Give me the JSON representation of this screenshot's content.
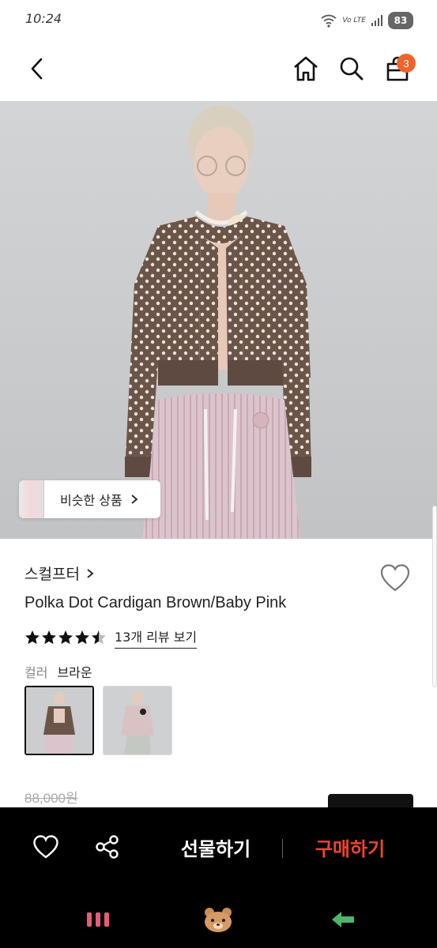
{
  "status": {
    "time": "10:24",
    "network": "Vo LTE",
    "battery": "83"
  },
  "header": {
    "cart_count": "3"
  },
  "hero": {
    "similar_label": "비슷한 상품"
  },
  "product": {
    "brand": "스컬프터",
    "name": "Polka Dot Cardigan Brown/Baby Pink",
    "rating": 4.5,
    "review_link": "13개 리뷰 보기",
    "color_label": "컬러",
    "color_value": "브라운",
    "price_original": "88,000원"
  },
  "bottom_bar": {
    "gift_label": "선물하기",
    "buy_label": "구매하기"
  },
  "colors": {
    "accent": "#f0642b",
    "buy": "#f0442b"
  }
}
